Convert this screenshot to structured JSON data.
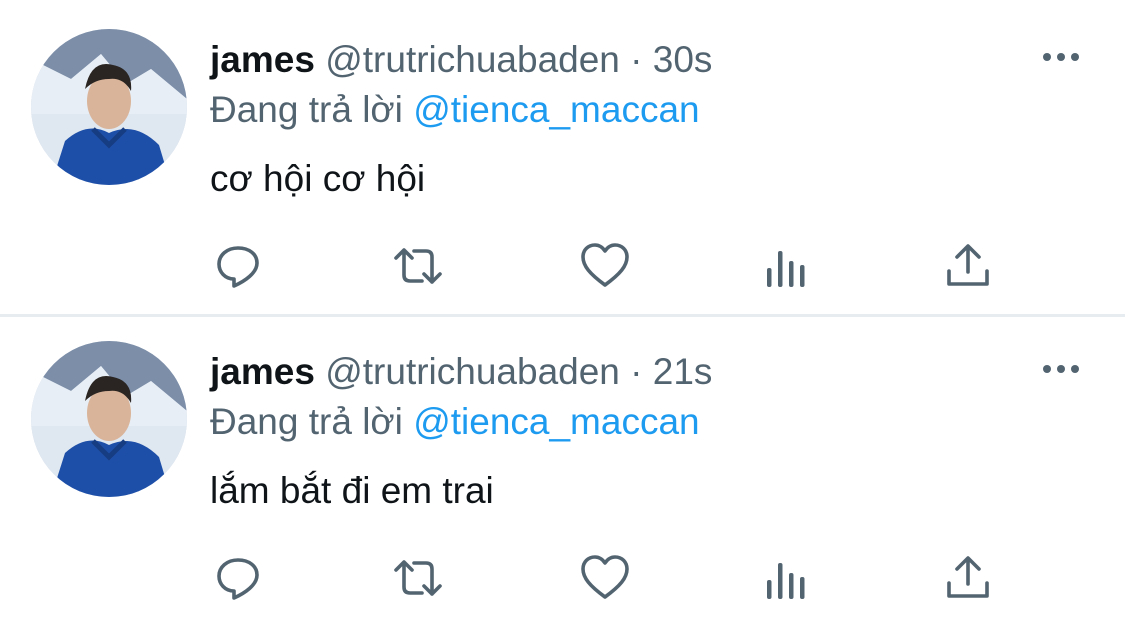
{
  "colors": {
    "text_primary": "#0f1419",
    "text_secondary": "#536471",
    "link": "#1d9bf0",
    "divider": "#e6ecf0"
  },
  "icons": [
    "avatar-photo",
    "more-icon",
    "reply-icon",
    "retweet-icon",
    "like-icon",
    "analytics-icon",
    "share-icon"
  ],
  "tweets": [
    {
      "name": "james",
      "handle": "@trutrichuabaden",
      "separator": "·",
      "time": "30s",
      "replying_to_label": "Đang trả lời",
      "replying_to_handle": "@tienca_maccan",
      "text": "cơ hội cơ hội"
    },
    {
      "name": "james",
      "handle": "@trutrichuabaden",
      "separator": "·",
      "time": "21s",
      "replying_to_label": "Đang trả lời",
      "replying_to_handle": "@tienca_maccan",
      "text": "lắm bắt đi em trai"
    }
  ]
}
